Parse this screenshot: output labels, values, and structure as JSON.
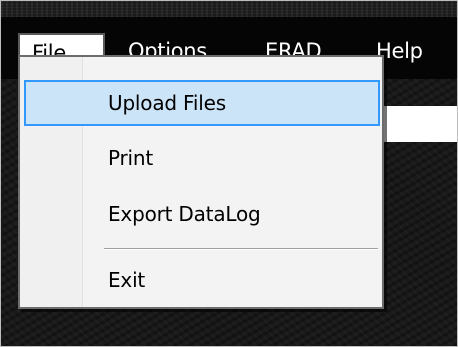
{
  "menubar": {
    "file_label": "File",
    "options_label": "Options",
    "erad_label": "ERAD",
    "help_label": "Help"
  },
  "file_menu": {
    "items": [
      {
        "label": "Upload Files",
        "highlighted": true
      },
      {
        "label": "Print"
      },
      {
        "label": "Export DataLog"
      },
      {
        "label": "Exit"
      }
    ]
  },
  "colors": {
    "highlight_fill": "#cce4f7",
    "highlight_border": "#3399ff",
    "menubar_background": "#050505"
  }
}
